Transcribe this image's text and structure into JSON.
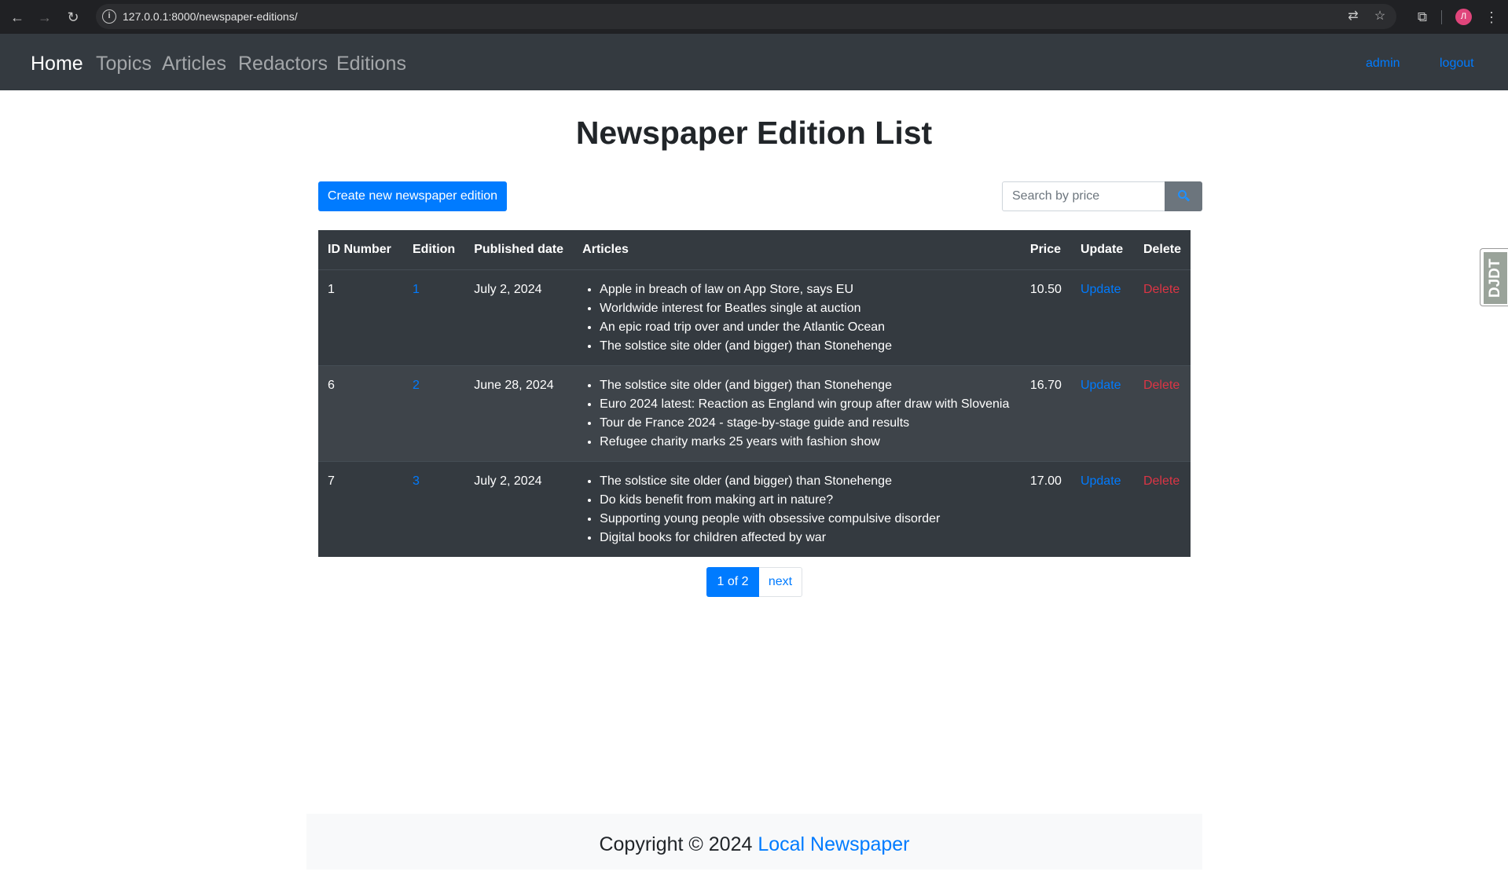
{
  "browser": {
    "url": "127.0.0.1:8000/newspaper-editions/",
    "profile_initial": "Л"
  },
  "navbar": {
    "links": [
      "Home",
      "Topics",
      "Articles",
      "Redactors",
      "Editions"
    ],
    "user": "admin",
    "logout": "logout"
  },
  "debug_toolbar": {
    "label": "DJDT"
  },
  "page": {
    "title": "Newspaper Edition List",
    "create_button": "Create new newspaper edition",
    "search_placeholder": "Search by price"
  },
  "table": {
    "headers": [
      "ID Number",
      "Edition",
      "Published date",
      "Articles",
      "Price",
      "Update",
      "Delete"
    ],
    "rows": [
      {
        "id": "1",
        "edition": "1",
        "date": "July 2, 2024",
        "articles": [
          "Apple in breach of law on App Store, says EU",
          "Worldwide interest for Beatles single at auction",
          "An epic road trip over and under the Atlantic Ocean",
          "The solstice site older (and bigger) than Stonehenge"
        ],
        "price": "10.50",
        "update": "Update",
        "delete": "Delete"
      },
      {
        "id": "6",
        "edition": "2",
        "date": "June 28, 2024",
        "articles": [
          "The solstice site older (and bigger) than Stonehenge",
          "Euro 2024 latest: Reaction as England win group after draw with Slovenia",
          "Tour de France 2024 - stage-by-stage guide and results",
          "Refugee charity marks 25 years with fashion show"
        ],
        "price": "16.70",
        "update": "Update",
        "delete": "Delete"
      },
      {
        "id": "7",
        "edition": "3",
        "date": "July 2, 2024",
        "articles": [
          "The solstice site older (and bigger) than Stonehenge",
          "Do kids benefit from making art in nature?",
          "Supporting young people with obsessive compulsive disorder",
          "Digital books for children affected by war"
        ],
        "price": "17.00",
        "update": "Update",
        "delete": "Delete"
      }
    ]
  },
  "pagination": {
    "current": "1 of 2",
    "next": "next"
  },
  "footer": {
    "text": "Copyright © 2024 ",
    "brand": "Local Newspaper"
  },
  "colors": {
    "navbar": "#343a40",
    "primary": "#007bff",
    "danger": "#dc3545"
  }
}
